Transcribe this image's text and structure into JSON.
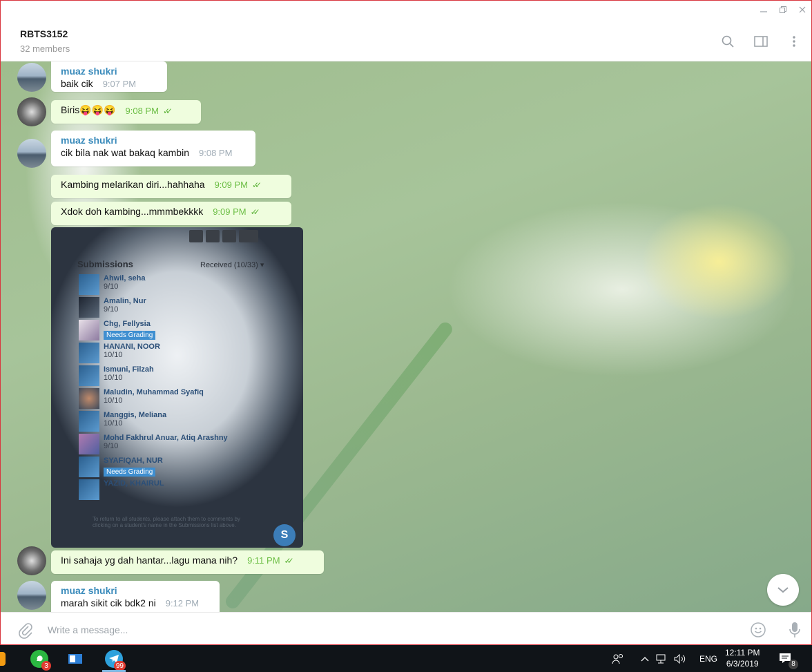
{
  "window": {
    "minimize": "—",
    "restore": "▫",
    "close": "✕"
  },
  "header": {
    "title": "RBTS3152",
    "subtitle": "32 members"
  },
  "messages": [
    {
      "sender": "muaz shukri",
      "text": "baik cik",
      "time": "9:07 PM"
    },
    {
      "text": "Biris😝😝😝",
      "time": "9:08 PM"
    },
    {
      "sender": "muaz shukri",
      "text": "cik bila nak wat bakaq kambin",
      "time": "9:08 PM"
    },
    {
      "text": "Kambing melarikan diri...hahhaha",
      "time": "9:09 PM"
    },
    {
      "text": "Xdok doh kambing...mmmbekkkk",
      "time": "9:09 PM"
    },
    {
      "text": "Ini sahaja yg dah hantar...lagu mana nih?",
      "time": "9:11 PM"
    },
    {
      "sender": "muaz shukri",
      "text": "marah sikit cik bdk2 ni",
      "time": "9:12 PM"
    }
  ],
  "photo": {
    "title": "Submissions",
    "received": "Received (10/33) ▾",
    "rows": [
      {
        "name": "Ahwil, seha",
        "score": "9/10"
      },
      {
        "name": "Amalin, Nur",
        "score": "9/10"
      },
      {
        "name": "Chg, Fellysia",
        "badge": "Needs Grading"
      },
      {
        "name": "HANANI, NOOR",
        "score": "10/10"
      },
      {
        "name": "Ismuni, Filzah",
        "score": "10/10"
      },
      {
        "name": "Maludin, Muhammad Syafiq",
        "score": "10/10"
      },
      {
        "name": "Manggis, Meliana",
        "score": "10/10"
      },
      {
        "name": "Mohd Fakhrul Anuar, Atiq Arashny",
        "score": "9/10"
      },
      {
        "name": "SYAFIQAH, NUR",
        "badge": "Needs Grading"
      },
      {
        "name": "YAZID, KHAIRUL",
        "score": ""
      }
    ],
    "footer": "To return to all students, please attach them to comments by clicking on a student's name in the Submissions list above.",
    "logo": "S"
  },
  "composer": {
    "placeholder": "Write a message..."
  },
  "taskbar": {
    "whatsapp_badge": "3",
    "telegram_badge": "99",
    "lang": "ENG",
    "time": "12:11 PM",
    "date": "6/3/2019",
    "notif_count": "8"
  }
}
